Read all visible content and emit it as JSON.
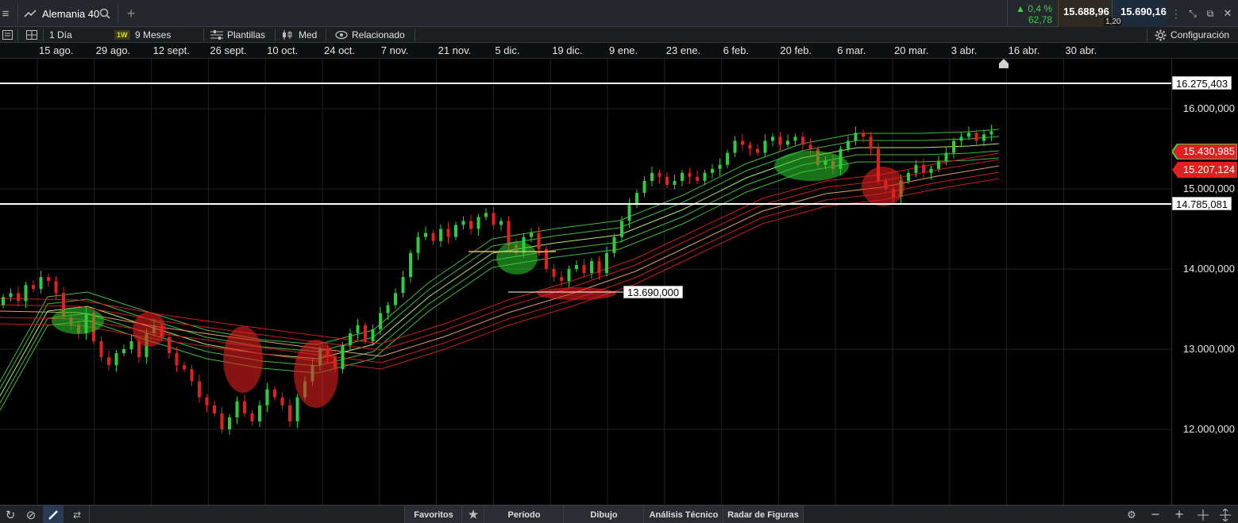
{
  "instrument": {
    "name": "Alemania 40"
  },
  "quote": {
    "change_pct": "0,4 %",
    "change_abs": "62,78",
    "sell": "15.688,96",
    "buy": "15.690,16",
    "spread": "1,20"
  },
  "toolbar": {
    "interval": "1 Día",
    "timeframe_badge": "1W",
    "range": "9 Meses",
    "templates": "Plantillas",
    "price_type": "Med",
    "related": "Relacionado",
    "settings": "Configuración"
  },
  "dates": [
    "15 ago.",
    "29 ago.",
    "12 sept.",
    "26 sept.",
    "10 oct.",
    "24 oct.",
    "7 nov.",
    "21 nov.",
    "5 dic.",
    "19 dic.",
    "9 ene.",
    "23 ene.",
    "6 feb.",
    "20 feb.",
    "6 mar.",
    "20 mar.",
    "3 abr.",
    "16 abr.",
    "30 abr."
  ],
  "price_axis": {
    "ticks": [
      "16.000,000",
      "15.000,000",
      "14.000,000",
      "13.000,000",
      "12.000,000"
    ],
    "line_high": "16.275,403",
    "line_low": "14.785,081",
    "tag_green": "15.430,985",
    "tag_red": "15.207,124",
    "annotation": "13.690,000"
  },
  "bottom": {
    "favorites": "Favoritos",
    "period": "Período",
    "drawing": "Dibujo",
    "technical": "Análisis Técnico",
    "patterns": "Radar de Figuras"
  },
  "colors": {
    "up": "#2ecc40",
    "down": "#e0221f",
    "accent_green": "#3ecf4b",
    "background": "#000000"
  }
}
